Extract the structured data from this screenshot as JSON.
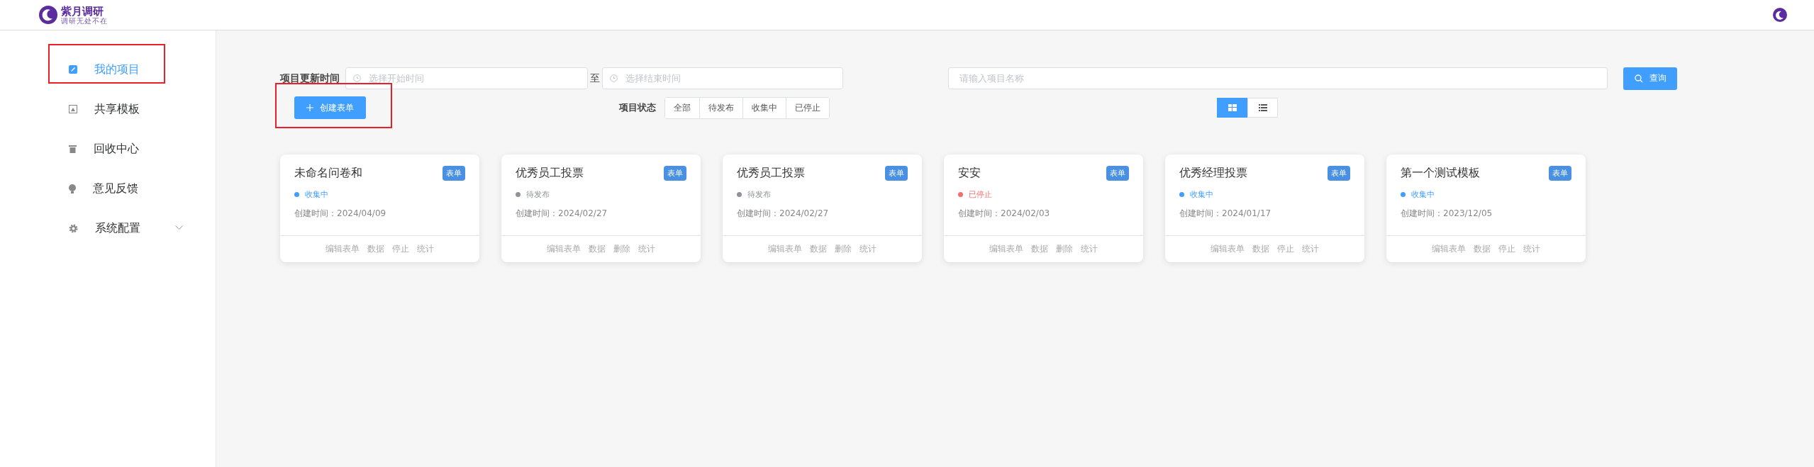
{
  "header": {
    "logo_title": "紫月调研",
    "logo_subtitle": "调研无处不在"
  },
  "sidebar": {
    "items": [
      {
        "kind": "edit",
        "label": "我的项目",
        "selected": true,
        "highlighted": true,
        "expandable": false
      },
      {
        "kind": "image",
        "label": "共享模板",
        "selected": false,
        "highlighted": false,
        "expandable": false
      },
      {
        "kind": "trash",
        "label": "回收中心",
        "selected": false,
        "highlighted": false,
        "expandable": false
      },
      {
        "kind": "bulb",
        "label": "意见反馈",
        "selected": false,
        "highlighted": false,
        "expandable": false
      },
      {
        "kind": "gear",
        "label": "系统配置",
        "selected": false,
        "highlighted": false,
        "expandable": true
      }
    ]
  },
  "filters": {
    "date_label": "项目更新时间",
    "start_placeholder": "选择开始时间",
    "separator": "至",
    "end_placeholder": "选择结束时间",
    "search_placeholder": "请输入项目名称",
    "search_button": "查询"
  },
  "create_button": {
    "label": "创建表单",
    "highlighted": true
  },
  "status_filter": {
    "label": "项目状态",
    "options": [
      {
        "label": "全部",
        "selected": false
      },
      {
        "label": "待发布",
        "selected": false
      },
      {
        "label": "收集中",
        "selected": false
      },
      {
        "label": "已停止",
        "selected": false
      }
    ]
  },
  "view_toggle": [
    {
      "kind": "grid",
      "selected": true
    },
    {
      "kind": "list",
      "selected": false
    }
  ],
  "cards": [
    {
      "title": "未命名问卷和",
      "tag": "表单",
      "status": "收集中",
      "color": "#409eff",
      "created": "创建时间：2024/04/09",
      "actions": [
        "编辑表单",
        "数据",
        "停止",
        "统计"
      ]
    },
    {
      "title": "优秀员工投票",
      "tag": "表单",
      "status": "待发布",
      "color": "#909399",
      "created": "创建时间：2024/02/27",
      "actions": [
        "编辑表单",
        "数据",
        "删除",
        "统计"
      ]
    },
    {
      "title": "优秀员工投票",
      "tag": "表单",
      "status": "待发布",
      "color": "#909399",
      "created": "创建时间：2024/02/27",
      "actions": [
        "编辑表单",
        "数据",
        "删除",
        "统计"
      ]
    },
    {
      "title": "安安",
      "tag": "表单",
      "status": "已停止",
      "color": "#f56c6c",
      "created": "创建时间：2024/02/03",
      "actions": [
        "编辑表单",
        "数据",
        "删除",
        "统计"
      ]
    },
    {
      "title": "优秀经理投票",
      "tag": "表单",
      "status": "收集中",
      "color": "#409eff",
      "created": "创建时间：2024/01/17",
      "actions": [
        "编辑表单",
        "数据",
        "停止",
        "统计"
      ]
    },
    {
      "title": "第一个测试模板",
      "tag": "表单",
      "status": "收集中",
      "color": "#409eff",
      "created": "创建时间：2023/12/05",
      "actions": [
        "编辑表单",
        "数据",
        "停止",
        "统计"
      ]
    }
  ]
}
